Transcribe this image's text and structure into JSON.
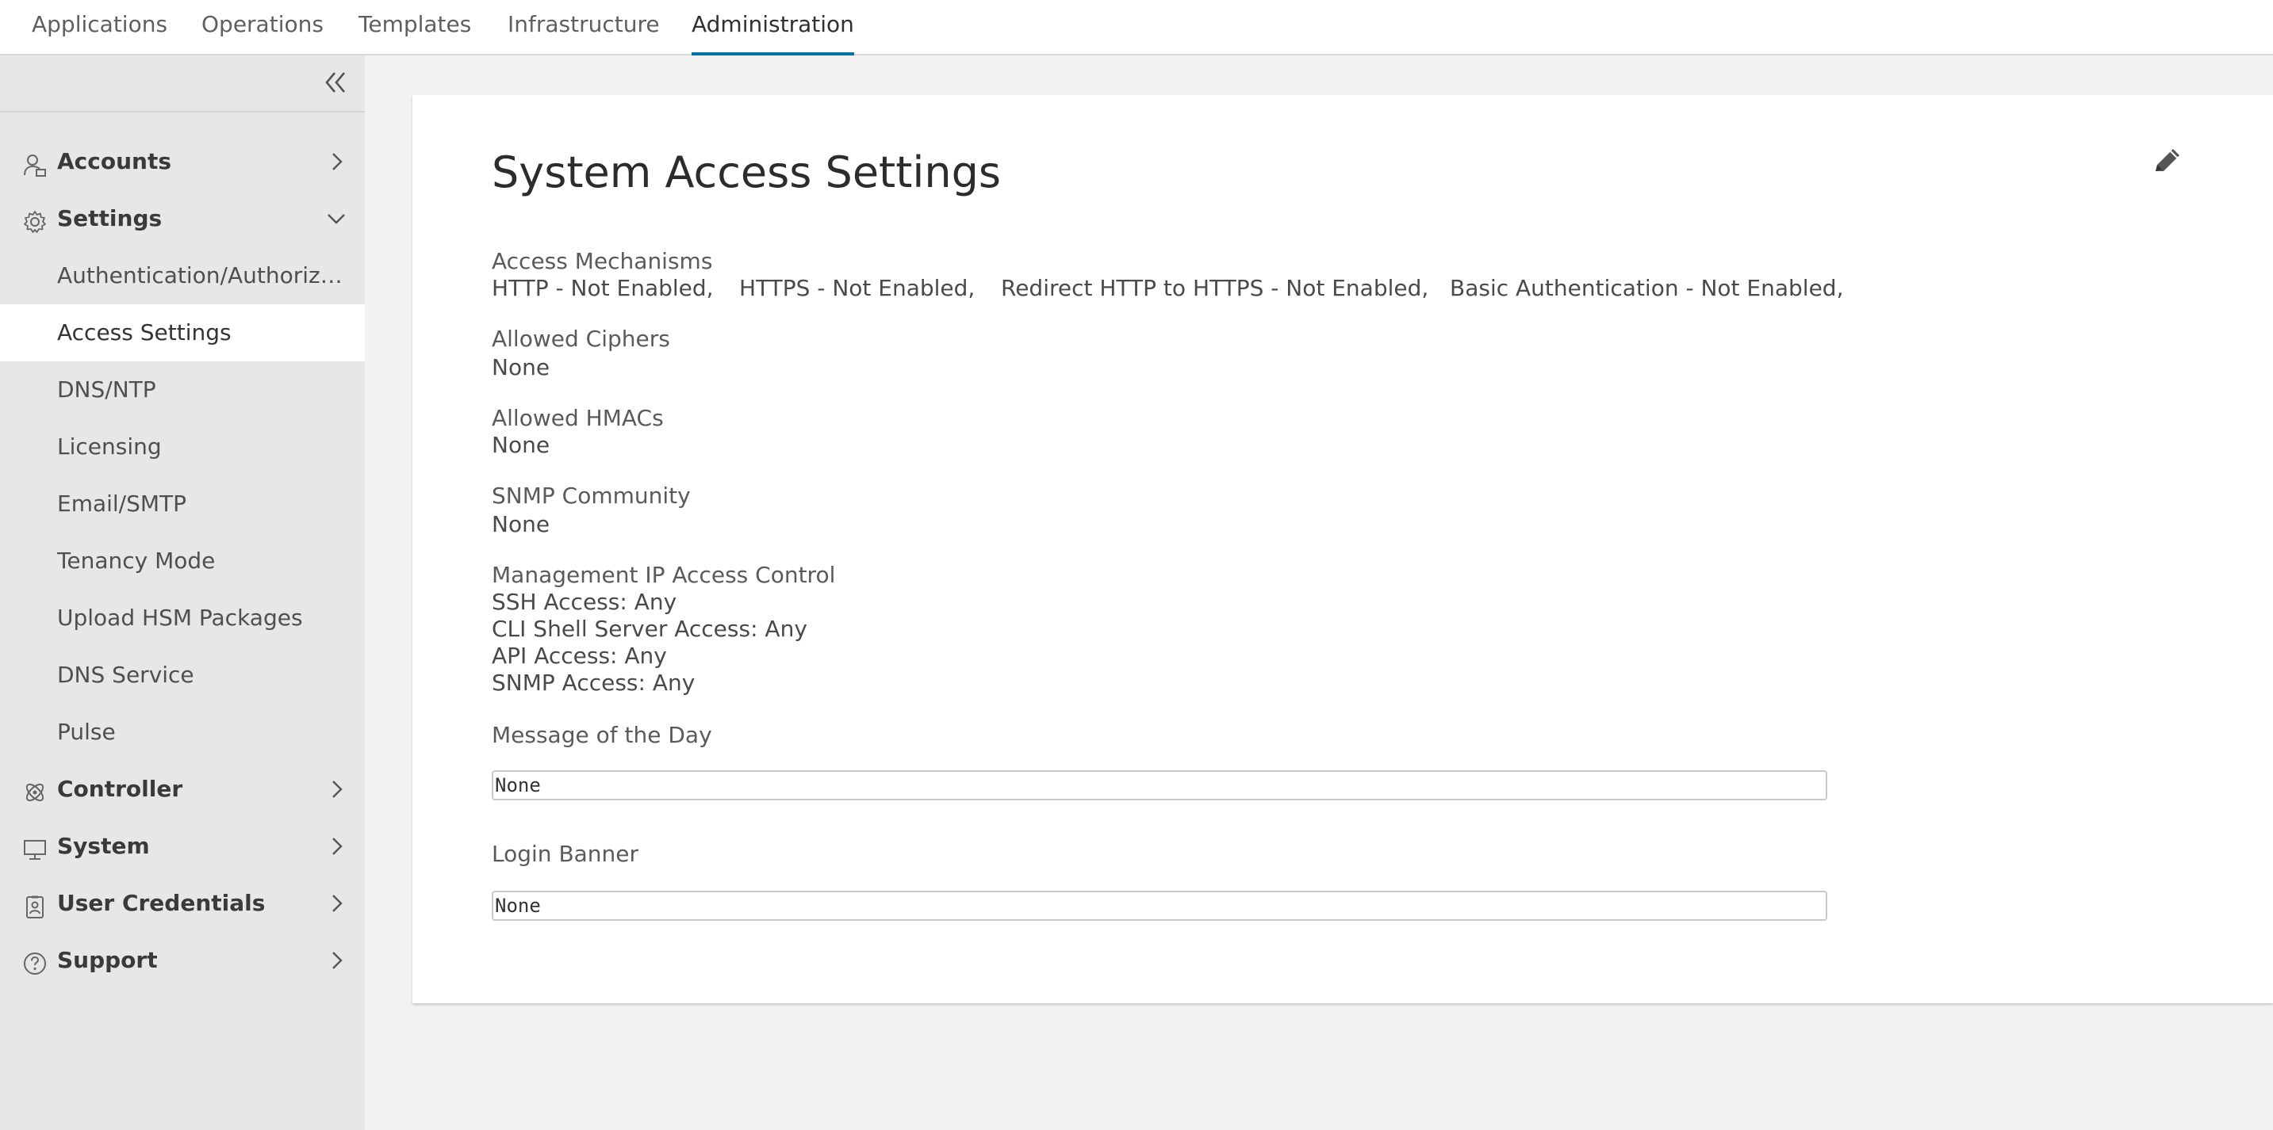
{
  "topnav": {
    "tabs": [
      {
        "label": "Applications"
      },
      {
        "label": "Operations"
      },
      {
        "label": "Templates"
      },
      {
        "label": "Infrastructure"
      },
      {
        "label": "Administration",
        "active": true
      }
    ]
  },
  "sidebar": {
    "accounts": {
      "label": "Accounts",
      "icon": "accounts-icon"
    },
    "settings": {
      "label": "Settings",
      "icon": "gear-icon",
      "expanded": true
    },
    "sub_items": [
      {
        "label": "Authentication/Authorization"
      },
      {
        "label": "Access Settings",
        "active": true
      },
      {
        "label": "DNS/NTP"
      },
      {
        "label": "Licensing"
      },
      {
        "label": "Email/SMTP"
      },
      {
        "label": "Tenancy Mode"
      },
      {
        "label": "Upload HSM Packages"
      },
      {
        "label": "DNS Service"
      },
      {
        "label": "Pulse"
      }
    ],
    "controller": {
      "label": "Controller",
      "icon": "controller-icon"
    },
    "system": {
      "label": "System",
      "icon": "monitor-icon"
    },
    "user_credentials": {
      "label": "User Credentials",
      "icon": "badge-icon"
    },
    "support": {
      "label": "Support",
      "icon": "help-icon"
    }
  },
  "main": {
    "title": "System Access Settings",
    "access_mechanisms": {
      "label": "Access Mechanisms",
      "items": [
        "HTTP - Not Enabled,",
        "HTTPS - Not Enabled,",
        "Redirect HTTP to HTTPS - Not Enabled,",
        "Basic Authentication - Not Enabled,"
      ]
    },
    "allowed_ciphers": {
      "label": "Allowed Ciphers",
      "value": "None"
    },
    "allowed_hmacs": {
      "label": "Allowed HMACs",
      "value": "None"
    },
    "snmp_community": {
      "label": "SNMP Community",
      "value": "None"
    },
    "mgmt_ip": {
      "label": "Management IP Access Control",
      "lines": [
        "SSH Access: Any",
        "CLI Shell Server Access: Any",
        "API Access: Any",
        "SNMP Access: Any"
      ]
    },
    "motd": {
      "label": "Message of the Day",
      "value": "None"
    },
    "login_banner": {
      "label": "Login Banner",
      "value": "None"
    }
  },
  "colors": {
    "accent": "#0072a3",
    "sidebar_bg": "#e7e7e7",
    "page_bg": "#f2f2f2"
  }
}
